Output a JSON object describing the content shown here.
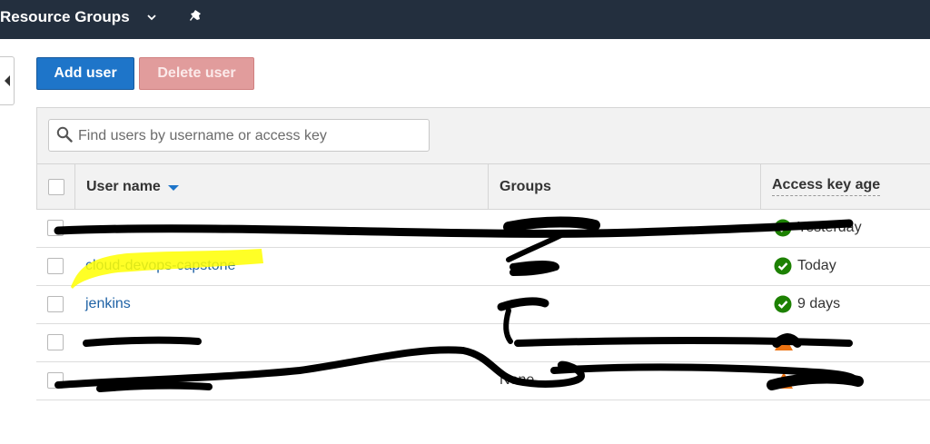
{
  "topnav": {
    "resource_groups_label": "Resource Groups",
    "chevron_icon": "chevron-down-icon",
    "pin_icon": "pin-icon",
    "background": "#232f3e"
  },
  "toolbar": {
    "add_user_label": "Add user",
    "delete_user_label": "Delete user"
  },
  "search": {
    "placeholder": "Find users by username or access key",
    "value": ""
  },
  "table": {
    "columns": {
      "user_name": "User name",
      "groups": "Groups",
      "access_key_age": "Access key age"
    },
    "sort_column": "User name",
    "rows": [
      {
        "user": "",
        "group": "",
        "age": "Yesterday",
        "status": "ok",
        "redacted": true
      },
      {
        "user": "cloud-devops-capstone",
        "group": "",
        "age": "Today",
        "status": "ok",
        "highlighted": true
      },
      {
        "user": "jenkins",
        "group": "",
        "age": "9 days",
        "status": "ok"
      },
      {
        "user": "",
        "group": "",
        "age": "",
        "status": "warning",
        "redacted": true
      },
      {
        "user": "",
        "group": "None",
        "age": "",
        "status": "warning",
        "redacted": true
      }
    ]
  },
  "colors": {
    "primary_button": "#1e75c9",
    "disabled_danger_button": "#e19c9c",
    "link": "#1f62a5",
    "ok_status": "#1d8102",
    "warning_status": "#ec7211",
    "highlight": "#ffff00"
  }
}
